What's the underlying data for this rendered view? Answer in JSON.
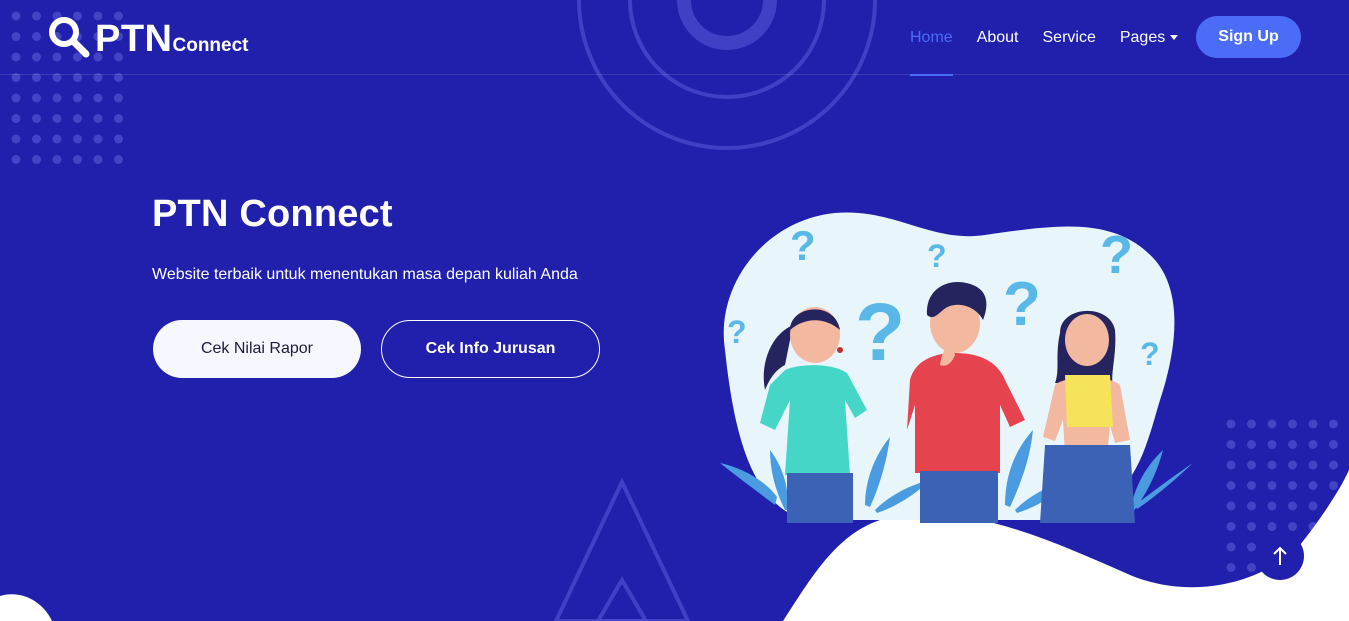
{
  "header": {
    "logo_main": "PTN",
    "logo_sub": "Connect",
    "nav": [
      {
        "label": "Home"
      },
      {
        "label": "About"
      },
      {
        "label": "Service"
      },
      {
        "label": "Pages"
      }
    ],
    "signup_label": "Sign Up"
  },
  "hero": {
    "title": "PTN Connect",
    "subtitle": "Website terbaik untuk menentukan masa depan kuliah Anda",
    "primary_button": "Cek Nilai Rapor",
    "secondary_button": "Cek Info Jurusan"
  },
  "icons": {
    "logo": "search-icon",
    "nav_caret": "chevron-down-icon",
    "scroll_top": "arrow-up-icon"
  },
  "colors": {
    "background": "#2120ad",
    "accent": "#4a6cf7",
    "button_light": "#f5f8ff"
  }
}
